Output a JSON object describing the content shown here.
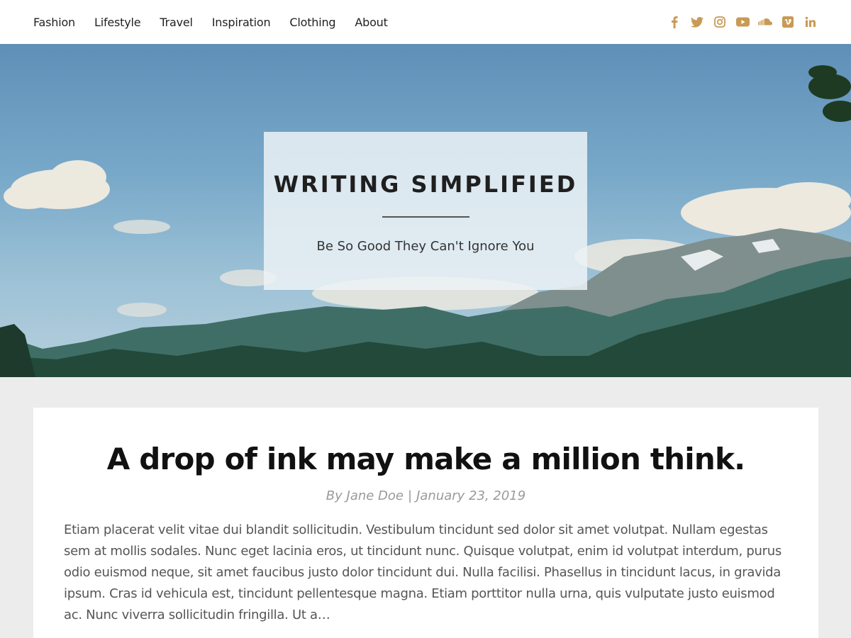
{
  "nav": {
    "items": [
      {
        "label": "Fashion"
      },
      {
        "label": "Lifestyle"
      },
      {
        "label": "Travel"
      },
      {
        "label": "Inspiration"
      },
      {
        "label": "Clothing"
      },
      {
        "label": "About"
      }
    ]
  },
  "social": {
    "color": "#c89a55",
    "icons": [
      "facebook-icon",
      "twitter-icon",
      "instagram-icon",
      "youtube-icon",
      "soundcloud-icon",
      "vimeo-icon",
      "linkedin-icon"
    ]
  },
  "hero": {
    "site_title": "WRITING SIMPLIFIED",
    "tagline": "Be So Good They Can't Ignore You"
  },
  "post": {
    "title": "A drop of ink may make a million think.",
    "author": "By Jane Doe",
    "separator": "|",
    "date": "January 23, 2019",
    "excerpt": "Etiam placerat velit vitae dui blandit sollicitudin. Vestibulum tincidunt sed dolor sit amet volutpat. Nullam egestas sem at mollis sodales. Nunc eget lacinia eros, ut tincidunt nunc. Quisque volutpat, enim id volutpat interdum, purus odio euismod neque, sit amet faucibus justo dolor tincidunt dui. Nulla facilisi. Phasellus in tincidunt lacus, in gravida ipsum. Cras id vehicula est, tincidunt pellentesque magna. Etiam porttitor nulla urna, quis vulputate justo euismod ac. Nunc viverra sollicitudin fringilla. Ut a…"
  }
}
